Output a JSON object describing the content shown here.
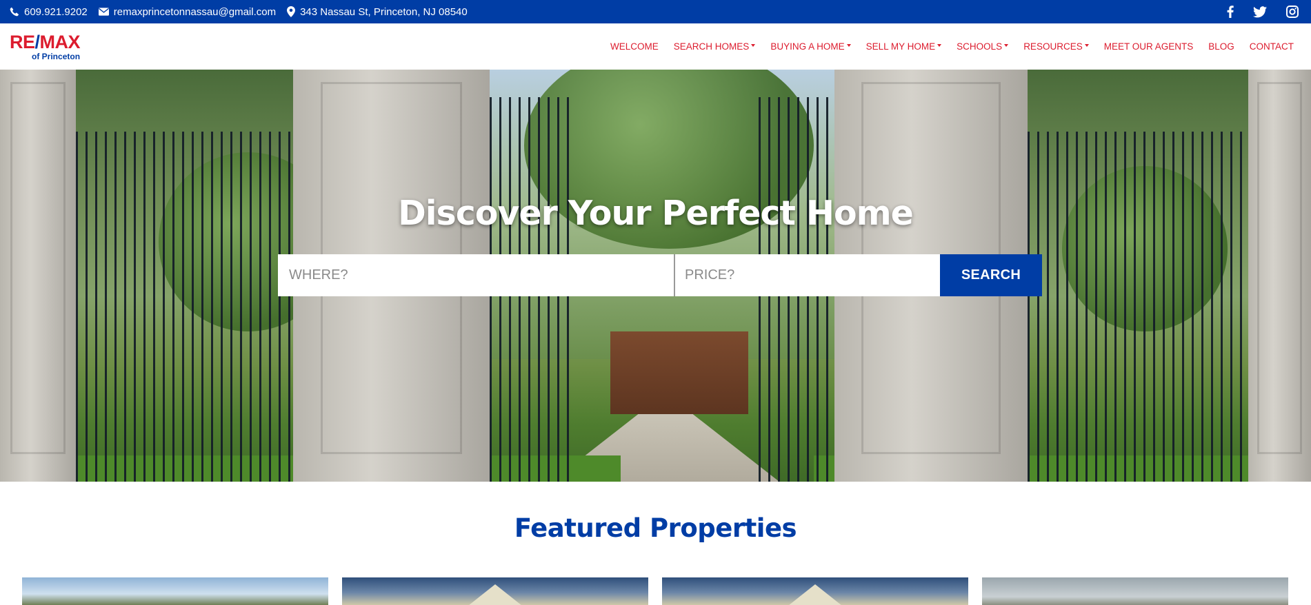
{
  "topbar": {
    "phone": "609.921.9202",
    "email": "remaxprincetonnassau@gmail.com",
    "address": "343 Nassau St, Princeton, NJ 08540",
    "social": [
      "facebook-icon",
      "twitter-icon",
      "instagram-icon"
    ]
  },
  "logo": {
    "brand_left": "RE",
    "brand_slash": "/",
    "brand_right": "MAX",
    "sub": "of Princeton"
  },
  "nav": {
    "items": [
      {
        "label": "WELCOME",
        "dropdown": false
      },
      {
        "label": "SEARCH HOMES",
        "dropdown": true
      },
      {
        "label": "BUYING A HOME",
        "dropdown": true
      },
      {
        "label": "SELL MY HOME",
        "dropdown": true
      },
      {
        "label": "SCHOOLS",
        "dropdown": true
      },
      {
        "label": "RESOURCES",
        "dropdown": true
      },
      {
        "label": "MEET OUR AGENTS",
        "dropdown": false
      },
      {
        "label": "BLOG",
        "dropdown": false
      },
      {
        "label": "CONTACT",
        "dropdown": false
      }
    ]
  },
  "hero": {
    "title": "Discover Your Perfect Home",
    "where_placeholder": "WHERE?",
    "price_placeholder": "PRICE?",
    "search_label": "SEARCH"
  },
  "featured": {
    "title": "Featured Properties"
  },
  "colors": {
    "brand_blue": "#003da5",
    "brand_red": "#dc1c2e"
  }
}
